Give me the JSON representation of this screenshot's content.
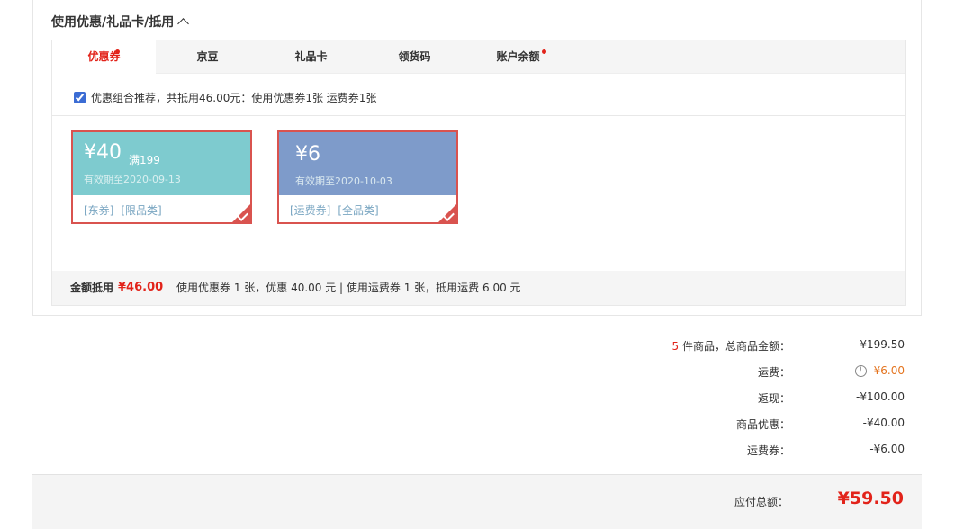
{
  "section": {
    "title": "使用优惠/礼品卡/抵用"
  },
  "tabs": [
    {
      "label": "优惠券",
      "dot": true,
      "active": true
    },
    {
      "label": "京豆",
      "dot": false
    },
    {
      "label": "礼品卡",
      "dot": false
    },
    {
      "label": "领货码",
      "dot": false
    },
    {
      "label": "账户余额",
      "dot": true
    }
  ],
  "combo": {
    "text": "优惠组合推荐，共抵用46.00元：使用优惠券1张 运费券1张",
    "checked": true
  },
  "coupons": [
    {
      "amount": "¥40",
      "condition": "满199",
      "expiry": "有效期至2020-09-13",
      "tags": [
        "[东券]",
        "[限品类]"
      ],
      "color": "#7ecbcf"
    },
    {
      "amount": "¥6",
      "condition": "",
      "expiry": "有效期至2020-10-03",
      "tags": [
        "[运费券]",
        "[全品类]"
      ],
      "color": "#7e9bca"
    }
  ],
  "summary": {
    "label": "金额抵用",
    "value": "¥46.00",
    "desc": "使用优惠券 1 张，优惠 40.00 元   | 使用运费券 1 张，抵用运费 6.00 元"
  },
  "fees": {
    "count": "5",
    "items_label": " 件商品，总商品金额：",
    "items_value": "¥199.50",
    "shipping_label": "运费：",
    "shipping_value": "¥6.00",
    "cashback_label": "返现：",
    "cashback_value": "-¥100.00",
    "discount_label": "商品优惠：",
    "discount_value": "-¥40.00",
    "shipcoupon_label": "运费券：",
    "shipcoupon_value": "-¥6.00"
  },
  "total": {
    "label": "应付总额：",
    "value": "¥59.50"
  },
  "colors": {
    "accent": "#e2231a",
    "coupon_border": "#d9534f",
    "shipping_value": "#e4741f"
  }
}
